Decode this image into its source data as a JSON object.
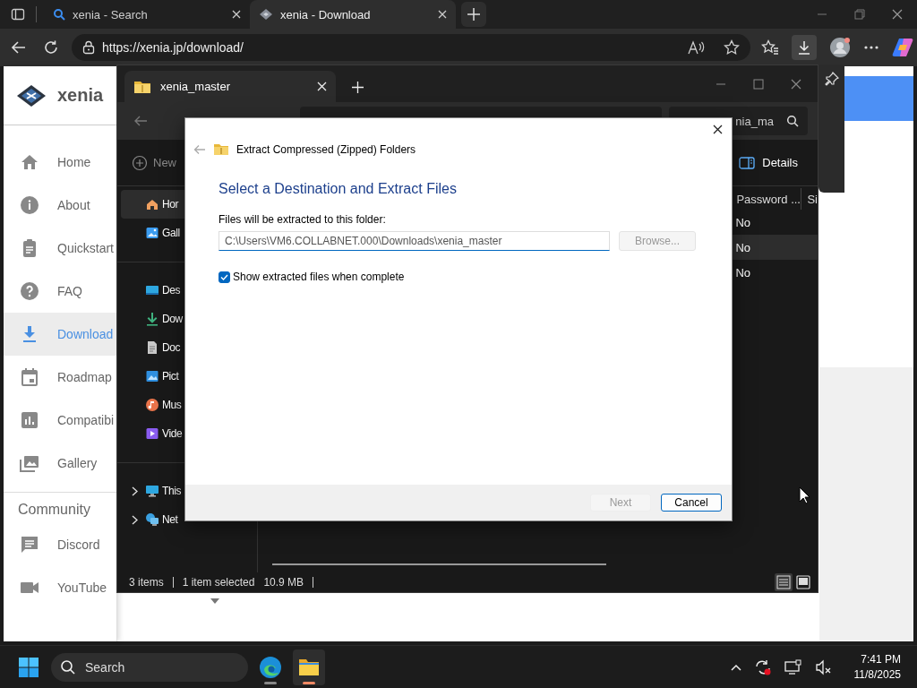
{
  "browser": {
    "tabs": [
      {
        "title": "xenia - Search",
        "kind": "search",
        "selected": false
      },
      {
        "title": "xenia - Download",
        "kind": "site",
        "selected": true
      }
    ],
    "url": "https://xenia.jp/download/"
  },
  "site": {
    "logo": "xenia",
    "nav": [
      {
        "label": "Home",
        "kind": "home",
        "selected": false
      },
      {
        "label": "About",
        "kind": "info",
        "selected": false
      },
      {
        "label": "Quickstart",
        "kind": "clipboard",
        "selected": false
      },
      {
        "label": "FAQ",
        "kind": "help",
        "selected": false
      },
      {
        "label": "Download",
        "kind": "download",
        "selected": true
      },
      {
        "label": "Roadmap",
        "kind": "calendar",
        "selected": false
      },
      {
        "label": "Compatibi",
        "kind": "chart",
        "selected": false
      },
      {
        "label": "Gallery",
        "kind": "gallery",
        "selected": false
      }
    ],
    "community": {
      "title": "Community",
      "items": [
        {
          "label": "Discord",
          "kind": "chat"
        },
        {
          "label": "YouTube",
          "kind": "video"
        }
      ]
    }
  },
  "explorer": {
    "tab_title": "xenia_master",
    "search_text": "nia_ma",
    "new_label": "New",
    "details_label": "Details",
    "nav_groups": [
      [
        {
          "label": "Hor",
          "kind": "home",
          "selected": true,
          "expandable": false
        },
        {
          "label": "Gall",
          "kind": "gallery",
          "selected": false,
          "expandable": false
        }
      ],
      [
        {
          "label": "Des",
          "kind": "desktop",
          "selected": false,
          "expandable": false
        },
        {
          "label": "Dow",
          "kind": "downloads",
          "selected": false,
          "expandable": false
        },
        {
          "label": "Doc",
          "kind": "documents",
          "selected": false,
          "expandable": false
        },
        {
          "label": "Pict",
          "kind": "pictures",
          "selected": false,
          "expandable": false
        },
        {
          "label": "Mus",
          "kind": "music",
          "selected": false,
          "expandable": false
        },
        {
          "label": "Vide",
          "kind": "videos",
          "selected": false,
          "expandable": false
        }
      ],
      [
        {
          "label": "This",
          "kind": "pc",
          "selected": false,
          "expandable": true
        },
        {
          "label": "Net",
          "kind": "network",
          "selected": false,
          "expandable": true
        }
      ]
    ],
    "columns": [
      "Password ...",
      "Si"
    ],
    "rows": [
      {
        "password": "No",
        "selected": false
      },
      {
        "password": "No",
        "selected": true
      },
      {
        "password": "No",
        "selected": false
      }
    ],
    "status": {
      "items": "3 items",
      "selection": "1 item selected",
      "size": "10.9 MB"
    },
    "views": [
      {
        "kind": "details",
        "selected": true
      },
      {
        "kind": "tiles",
        "selected": false
      }
    ]
  },
  "dialog": {
    "title": "Extract Compressed (Zipped) Folders",
    "heading": "Select a Destination and Extract Files",
    "field_label": "Files will be extracted to this folder:",
    "path": "C:\\Users\\VM6.COLLABNET.000\\Downloads\\xenia_master",
    "browse": {
      "label": "Browse...",
      "disabled": true
    },
    "show_files": {
      "label": "Show extracted files when complete",
      "checked": true
    },
    "buttons": [
      {
        "label": "Next",
        "disabled": true
      },
      {
        "label": "Cancel",
        "disabled": false
      }
    ]
  },
  "taskbar": {
    "search_placeholder": "Search",
    "apps": [
      {
        "kind": "edge",
        "active": false
      },
      {
        "kind": "explorer",
        "active": true
      }
    ],
    "time": "7:41 PM",
    "date": "11/8/2025"
  }
}
